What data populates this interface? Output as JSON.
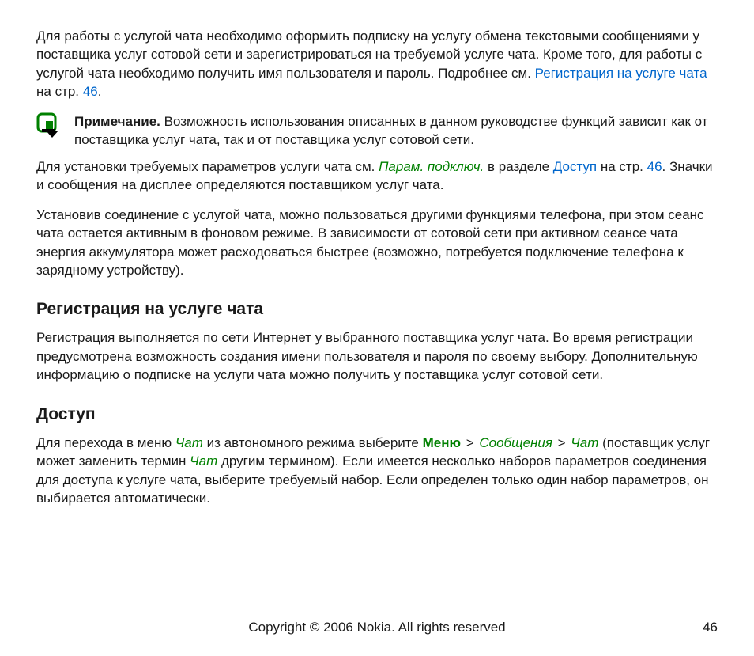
{
  "para1": {
    "t1": "Для работы с услугой чата необходимо оформить подписку на услугу обмена текстовыми сообщениями у поставщика услуг сотовой сети и зарегистрироваться на требуемой услуге чата. Кроме того, для работы с услугой чата необходимо получить имя пользователя и пароль. Подробнее см. ",
    "link1": "Регистрация на услуге чата",
    "t2": " на стр. ",
    "link2": "46",
    "t3": "."
  },
  "note": {
    "label": "Примечание.",
    "text": " Возможность использования описанных в данном руководстве функций зависит как от поставщика услуг чата, так и от поставщика услуг сотовой сети."
  },
  "para2": {
    "t1": "Для установки требуемых параметров услуги чата см. ",
    "g1": "Парам. подключ.",
    "t2": " в разделе ",
    "link1": "Доступ",
    "t3": " на стр. ",
    "link2": "46",
    "t4": ". Значки и сообщения на дисплее определяются поставщиком услуг чата."
  },
  "para3": "Установив соединение с услугой чата, можно пользоваться другими функциями телефона, при этом сеанс чата остается активным в фоновом режиме. В зависимости от сотовой сети при активном сеансе чата энергия аккумулятора может расходоваться быстрее (возможно, потребуется подключение телефона к зарядному устройству).",
  "h_reg": "Регистрация на услуге чата",
  "para4": "Регистрация выполняется по сети Интернет у выбранного поставщика услуг чата. Во время регистрации предусмотрена возможность создания имени пользователя и пароля по своему выбору. Дополнительную информацию о подписке на услуги чата можно получить у поставщика услуг сотовой сети.",
  "h_access": "Доступ",
  "para5": {
    "t1": "Для перехода в меню ",
    "g1": "Чат",
    "t2": " из автономного режима выберите ",
    "gb1": "Меню",
    "gt": " > ",
    "g2": "Сообщения",
    "g3": "Чат",
    "t3": " (поставщик услуг может заменить термин ",
    "g4": "Чат",
    "t4": " другим термином). Если имеется несколько наборов параметров соединения для доступа к услуге чата, выберите требуемый набор. Если определен только один набор параметров, он выбирается автоматически."
  },
  "footer": {
    "copyright": "Copyright © 2006 Nokia. All rights reserved",
    "page": "46"
  }
}
